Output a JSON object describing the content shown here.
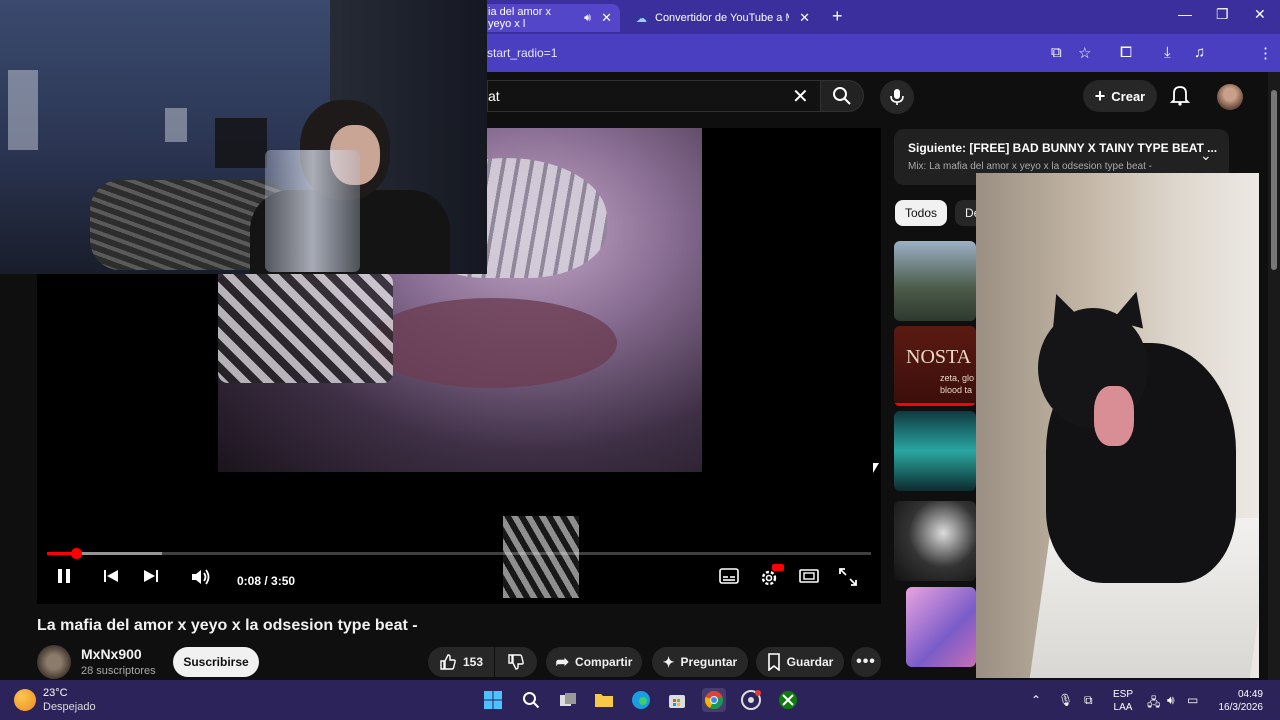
{
  "browser": {
    "tabs": [
      {
        "label": "ia del amor x yeyo x l",
        "active": true
      },
      {
        "label": "Convertidor de YouTube a MP3",
        "active": false
      }
    ],
    "address": "start_radio=1"
  },
  "header": {
    "search_value": "at",
    "create_label": "Crear"
  },
  "video": {
    "time": "0:08 / 3:50",
    "progress_fraction": 0.035,
    "buffered_fraction": 0.14,
    "title": "La mafia del amor x yeyo x la odsesion type beat -"
  },
  "channel": {
    "name": "MxNx900",
    "subscribers": "28 suscriptores",
    "subscribe_label": "Suscribirse"
  },
  "actions": {
    "likes": "153",
    "share": "Compartir",
    "ask": "Preguntar",
    "save": "Guardar"
  },
  "sidebar": {
    "next_label": "Siguiente: [FREE] BAD BUNNY X TAINY TYPE BEAT ...",
    "next_sub": "Mix: La mafia del amor x yeyo x la odsesion type beat -",
    "chips": [
      "Todos",
      "De"
    ],
    "thumb2_title": "NOSTA",
    "thumb2_sub1": "zeta, glo",
    "thumb2_sub2": "blood ta"
  },
  "taskbar": {
    "temperature": "23°C",
    "weather": "Despejado",
    "lang1": "ESP",
    "lang2": "LAA",
    "time": "04:49",
    "date": "16/3/2026"
  },
  "colors": {
    "accent": "#ff0000",
    "browser_bar": "#3b2f9e",
    "taskbar": "#2b2359"
  }
}
